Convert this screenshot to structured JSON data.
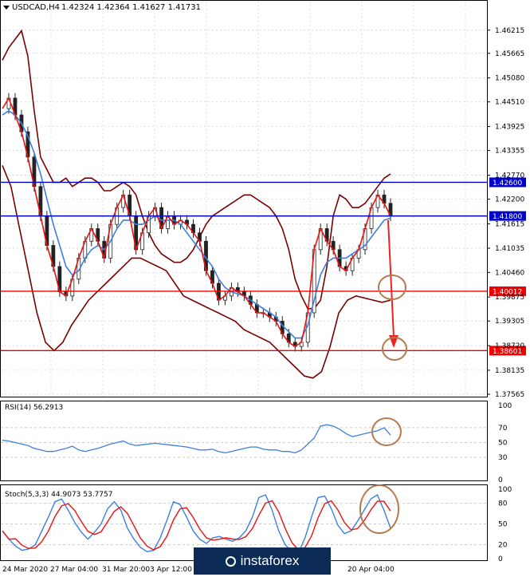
{
  "chart_data": {
    "type": "line",
    "symbol": "USDCAD,H4",
    "header_values": "1.42324 1.42364 1.41627 1.41731",
    "x_ticks": [
      "24 Mar 2020",
      "27 Mar 04:00",
      "31 Mar 20:00",
      "3 Apr 12:00",
      "20 Apr 04:00"
    ],
    "price_axis": {
      "ylim": [
        1.37565,
        1.4659
      ],
      "ticks": [
        "1.46215",
        "1.45665",
        "1.45080",
        "1.44510",
        "1.43925",
        "1.43355",
        "1.42770",
        "1.42200",
        "1.41615",
        "1.41035",
        "1.40460",
        "1.39875",
        "1.39305",
        "1.38720",
        "1.38135",
        "1.37565"
      ],
      "levels": [
        {
          "label": "1.42600",
          "value": 1.426,
          "color": "#0000cc"
        },
        {
          "label": "1.41800",
          "value": 1.418,
          "color": "#0000cc"
        },
        {
          "label": "1.40012",
          "value": 1.40012,
          "color": "#ee0000"
        },
        {
          "label": "1.38601",
          "value": 1.38601,
          "color": "#ee0000"
        }
      ],
      "close": [
        1.4435,
        1.446,
        1.442,
        1.438,
        1.432,
        1.425,
        1.418,
        1.411,
        1.406,
        1.4,
        1.399,
        1.403,
        1.408,
        1.412,
        1.415,
        1.412,
        1.408,
        1.416,
        1.42,
        1.423,
        1.418,
        1.41,
        1.414,
        1.418,
        1.42,
        1.415,
        1.418,
        1.416,
        1.417,
        1.416,
        1.414,
        1.412,
        1.405,
        1.402,
        1.398,
        1.399,
        1.401,
        1.4,
        1.399,
        1.397,
        1.395,
        1.395,
        1.394,
        1.393,
        1.39,
        1.388,
        1.387,
        1.388,
        1.395,
        1.41,
        1.415,
        1.412,
        1.41,
        1.406,
        1.405,
        1.408,
        1.41,
        1.415,
        1.42,
        1.423,
        1.421,
        1.418
      ],
      "sma": [
        1.442,
        1.443,
        1.442,
        1.44,
        1.437,
        1.433,
        1.428,
        1.422,
        1.416,
        1.411,
        1.406,
        1.404,
        1.405,
        1.408,
        1.41,
        1.411,
        1.41,
        1.412,
        1.415,
        1.417,
        1.417,
        1.416,
        1.416,
        1.417,
        1.418,
        1.417,
        1.417,
        1.417,
        1.416,
        1.414,
        1.412,
        1.41,
        1.408,
        1.406,
        1.403,
        1.401,
        1.4,
        1.3995,
        1.399,
        1.398,
        1.397,
        1.396,
        1.395,
        1.394,
        1.392,
        1.3905,
        1.389,
        1.389,
        1.392,
        1.398,
        1.404,
        1.407,
        1.408,
        1.408,
        1.408,
        1.409,
        1.41,
        1.411,
        1.413,
        1.415,
        1.417,
        1.4175
      ],
      "upper_band": [
        1.455,
        1.458,
        1.46,
        1.462,
        1.456,
        1.443,
        1.432,
        1.429,
        1.426,
        1.426,
        1.427,
        1.425,
        1.426,
        1.427,
        1.427,
        1.426,
        1.424,
        1.424,
        1.425,
        1.426,
        1.425,
        1.423,
        1.418,
        1.414,
        1.411,
        1.409,
        1.408,
        1.407,
        1.407,
        1.408,
        1.41,
        1.413,
        1.416,
        1.418,
        1.419,
        1.42,
        1.421,
        1.422,
        1.423,
        1.423,
        1.422,
        1.421,
        1.42,
        1.418,
        1.415,
        1.41,
        1.403,
        1.399,
        1.396,
        1.396,
        1.398,
        1.406,
        1.418,
        1.423,
        1.422,
        1.42,
        1.42,
        1.421,
        1.423,
        1.425,
        1.427,
        1.428
      ],
      "lower_band": [
        1.43,
        1.425,
        1.415,
        1.405,
        1.395,
        1.388,
        1.386,
        1.388,
        1.392,
        1.395,
        1.398,
        1.4,
        1.402,
        1.404,
        1.406,
        1.408,
        1.408,
        1.407,
        1.406,
        1.405,
        1.402,
        1.399,
        1.398,
        1.397,
        1.396,
        1.395,
        1.394,
        1.393,
        1.391,
        1.39,
        1.389,
        1.388,
        1.386,
        1.384,
        1.382,
        1.38,
        1.3795,
        1.381,
        1.387,
        1.395,
        1.398,
        1.399,
        1.3985,
        1.398,
        1.3975,
        1.398
      ]
    },
    "rsi": {
      "label": "RSI(14) 56.2913",
      "ylim": [
        0,
        100
      ],
      "ticks": [
        "100",
        "70",
        "50",
        "30",
        "0"
      ],
      "values": [
        53,
        52,
        50,
        48,
        46,
        42,
        40,
        38,
        38,
        40,
        42,
        45,
        40,
        38,
        40,
        42,
        45,
        48,
        50,
        52,
        48,
        46,
        47,
        48,
        49,
        48,
        47,
        46,
        45,
        44,
        42,
        40,
        40,
        41,
        38,
        36,
        38,
        40,
        42,
        44,
        44,
        41,
        40,
        40,
        38,
        38,
        36,
        40,
        48,
        56,
        72,
        74,
        72,
        68,
        62,
        58,
        60,
        62,
        64,
        66,
        70,
        60
      ]
    },
    "stochastic": {
      "label": "Stoch(5,3,3) 44.9073 53.7757",
      "ylim": [
        0,
        100
      ],
      "ticks": [
        "100",
        "80",
        "50",
        "20",
        "0"
      ],
      "k": [
        40,
        28,
        18,
        12,
        14,
        20,
        40,
        60,
        82,
        86,
        70,
        52,
        38,
        28,
        38,
        50,
        72,
        82,
        70,
        44,
        28,
        16,
        10,
        12,
        30,
        55,
        82,
        78,
        60,
        40,
        28,
        22,
        30,
        32,
        28,
        25,
        30,
        40,
        60,
        88,
        92,
        70,
        40,
        20,
        10,
        8,
        30,
        60,
        88,
        90,
        72,
        48,
        36,
        40,
        54,
        70,
        86,
        92,
        70,
        44
      ]
    }
  }
}
